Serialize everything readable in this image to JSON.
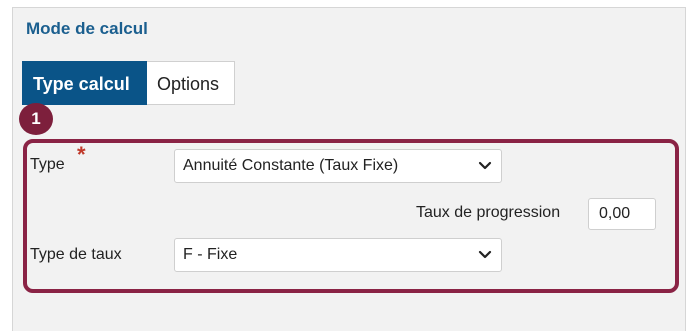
{
  "panel": {
    "title": "Mode de calcul"
  },
  "tabs": [
    {
      "label": "Type calcul",
      "active": true
    },
    {
      "label": "Options",
      "active": false
    }
  ],
  "badge": {
    "number": "1"
  },
  "form": {
    "type_label": "Type",
    "required_marker": "*",
    "type_value": "Annuité Constante (Taux Fixe)",
    "progression_label": "Taux de progression",
    "progression_value": "0,00",
    "rate_type_label": "Type de taux",
    "rate_type_value": "F - Fixe"
  },
  "colors": {
    "title": "#1b5f8f",
    "active_tab": "#0a5488",
    "highlight": "#8a2345",
    "badge": "#7d1f3c",
    "required": "#c0392b"
  }
}
